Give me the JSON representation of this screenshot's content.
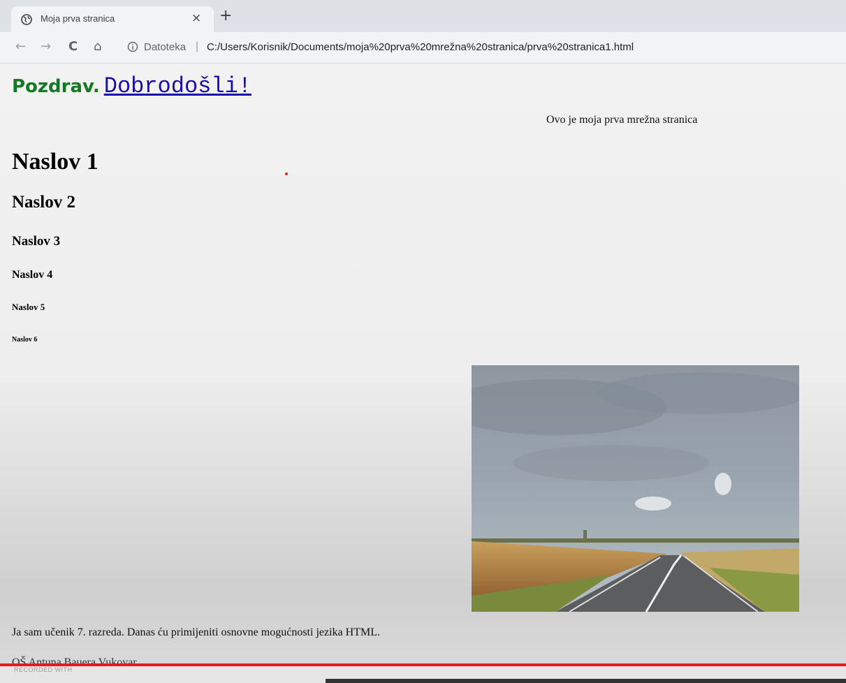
{
  "browser": {
    "tab": {
      "title": "Moja prva stranica",
      "close_glyph": "×"
    },
    "new_tab_glyph": "+",
    "nav": {
      "back": "←",
      "forward": "→",
      "reload": "C",
      "home": "⌂"
    },
    "address": {
      "scheme_label": "Datoteka",
      "separator": "|",
      "url": "C:/Users/Korisnik/Documents/moja%20prva%20mrežna%20stranica/prva%20stranica1.html"
    }
  },
  "page": {
    "greeting": "Pozdrav.",
    "welcome_link": "Dobrodošli!",
    "subtitle": "Ovo je moja prva mrežna stranica",
    "headings": {
      "h1": "Naslov 1",
      "h2": "Naslov 2",
      "h3": "Naslov 3",
      "h4": "Naslov 4",
      "h5": "Naslov 5",
      "h6": "Naslov 6"
    },
    "paragraph": "Ja sam učenik 7. razreda. Danas ću primijeniti osnovne mogućnosti jezika HTML.",
    "school": "OŠ Antuna Bauera Vukovar."
  },
  "overlay": {
    "watermark": "RECORDED WITH"
  },
  "colors": {
    "greeting": "#117a23",
    "link": "#1a0dab",
    "progress": "#e41b1b"
  }
}
